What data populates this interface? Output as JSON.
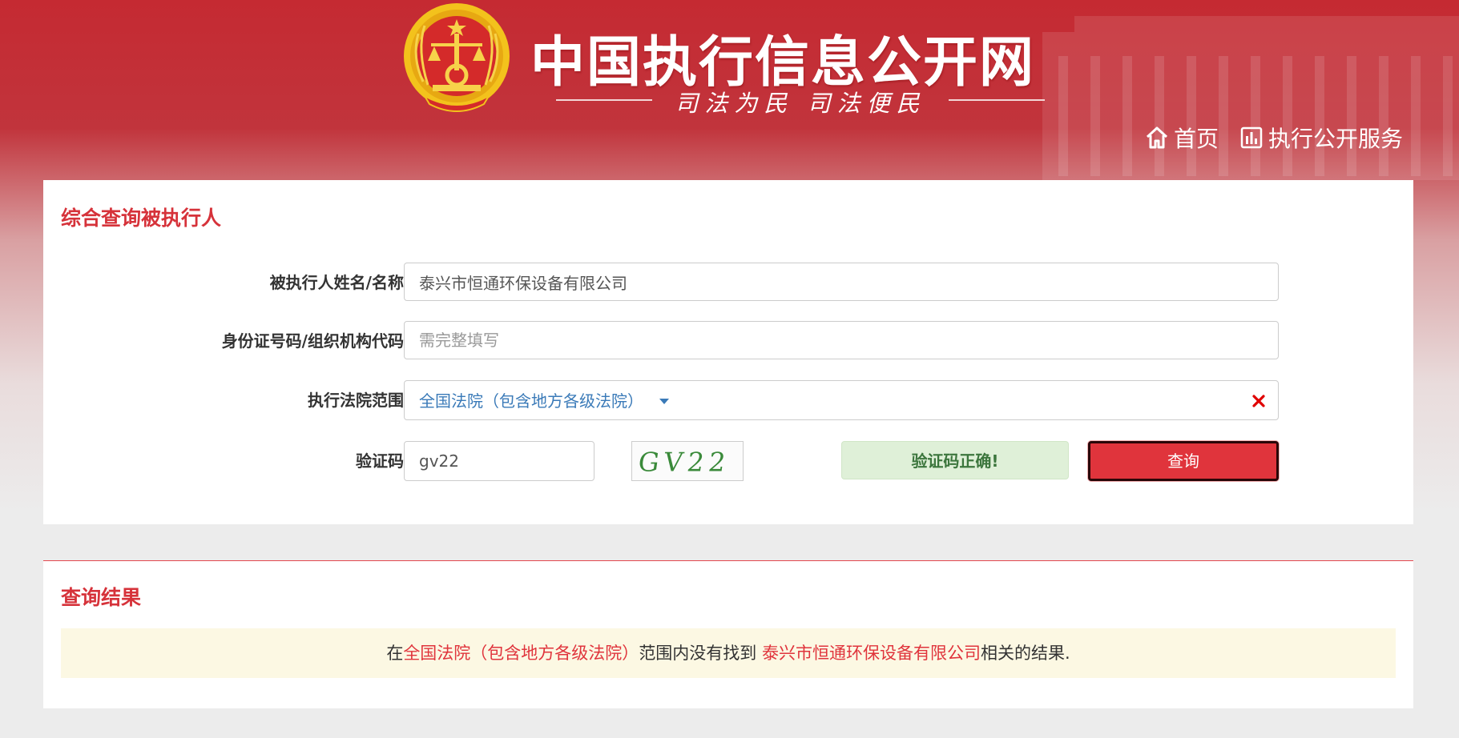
{
  "header": {
    "site_title": "中国执行信息公开网",
    "slogan": "司法为民  司法便民",
    "nav": [
      {
        "label": "首页",
        "icon": "home-icon"
      },
      {
        "label": "执行公开服务",
        "icon": "chart-bar-icon"
      }
    ]
  },
  "query_panel": {
    "title": "综合查询被执行人",
    "fields": {
      "name": {
        "label": "被执行人姓名/名称:",
        "value": "泰兴市恒通环保设备有限公司"
      },
      "id_code": {
        "label": "身份证号码/组织机构代码:",
        "placeholder": "需完整填写",
        "value": ""
      },
      "court": {
        "label": "执行法院范围:",
        "selected": "全国法院（包含地方各级法院）"
      },
      "captcha": {
        "label": "验证码:",
        "value": "gv22",
        "image_text": "GV22"
      }
    },
    "captcha_status": "验证码正确!",
    "query_button": "查询"
  },
  "results": {
    "title": "查询结果",
    "message": {
      "prefix": "在",
      "court": "全国法院（包含地方各级法院）",
      "middle": "范围内没有找到 ",
      "name": "泰兴市恒通环保设备有限公司",
      "suffix": "相关的结果."
    }
  },
  "colors": {
    "brand_red": "#d6323a",
    "button_red": "#e0343c",
    "link_blue": "#3a7ab8",
    "success_bg": "#dff0d8",
    "success_text": "#3c763d",
    "notice_bg": "#fcf8e3"
  }
}
